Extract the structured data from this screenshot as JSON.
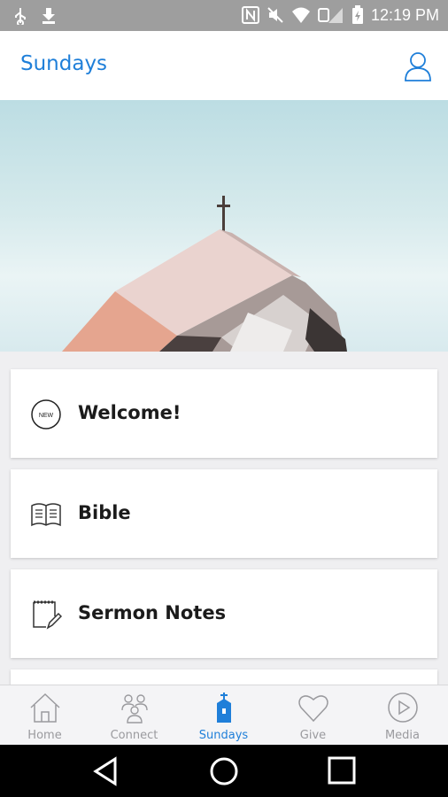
{
  "status_bar": {
    "time": "12:19 PM",
    "icons": [
      "usb-icon",
      "download-icon",
      "nfc-icon",
      "mute-icon",
      "wifi-icon",
      "signal-icon",
      "battery-icon"
    ]
  },
  "header": {
    "title": "Sundays",
    "profile_icon": "user-icon"
  },
  "hero": {
    "subject": "church-rooftop-with-cross"
  },
  "cards": [
    {
      "label": "Welcome!",
      "icon": "new-badge-icon"
    },
    {
      "label": "Bible",
      "icon": "open-book-icon"
    },
    {
      "label": "Sermon Notes",
      "icon": "notepad-pencil-icon"
    }
  ],
  "tabs": [
    {
      "label": "Home",
      "icon": "house-icon",
      "active": false
    },
    {
      "label": "Connect",
      "icon": "people-icon",
      "active": false
    },
    {
      "label": "Sundays",
      "icon": "church-icon",
      "active": true
    },
    {
      "label": "Give",
      "icon": "heart-icon",
      "active": false
    },
    {
      "label": "Media",
      "icon": "play-circle-icon",
      "active": false
    }
  ],
  "colors": {
    "accent": "#1f7fd9",
    "status_bar": "#9e9e9e",
    "tab_inactive": "#9a9a9e"
  }
}
